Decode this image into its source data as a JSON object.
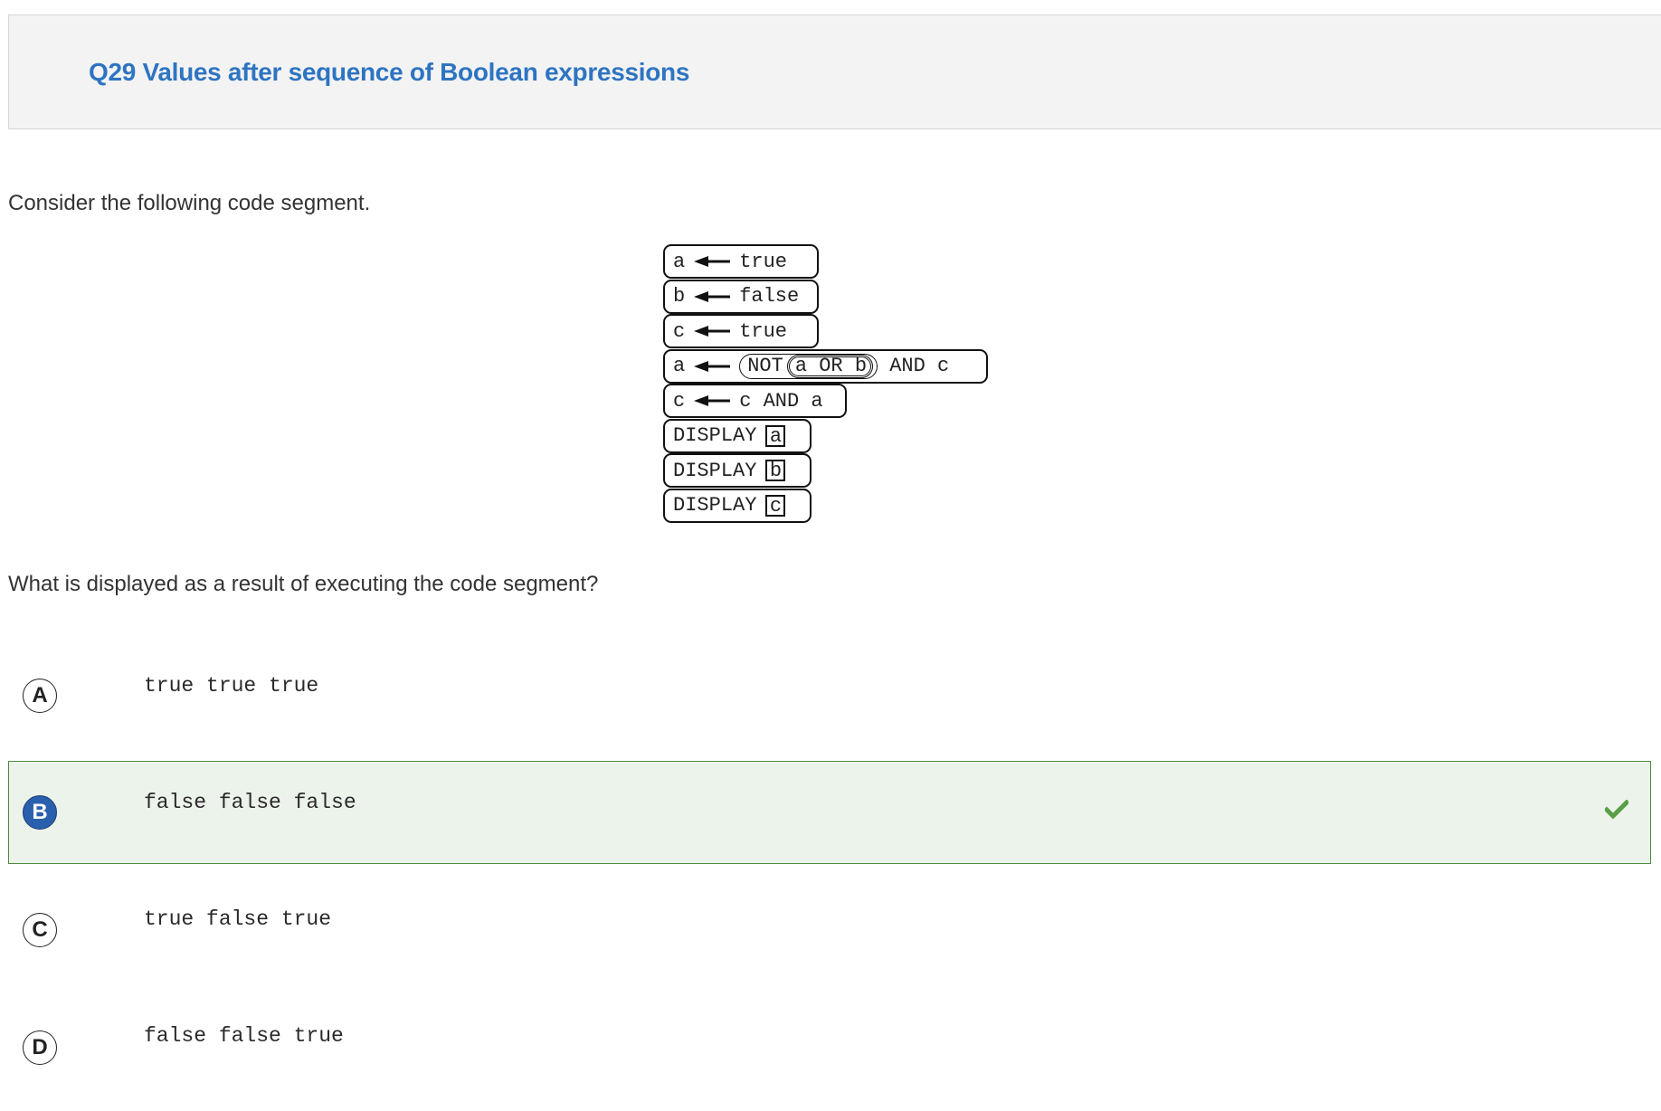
{
  "header": {
    "title": "Q29 Values after sequence of Boolean expressions"
  },
  "question": {
    "intro": "Consider the following code segment.",
    "prompt": "What is displayed as a result of executing the code segment?"
  },
  "code": {
    "lines": [
      {
        "type": "assign",
        "var": "a",
        "arrow": "assign-arrow-icon",
        "expr": "true"
      },
      {
        "type": "assign",
        "var": "b",
        "arrow": "assign-arrow-icon",
        "expr": "false"
      },
      {
        "type": "assign",
        "var": "c",
        "arrow": "assign-arrow-icon",
        "expr": "true"
      },
      {
        "type": "assign-compound",
        "var": "a",
        "arrow": "assign-arrow-icon",
        "not_kw": "NOT",
        "inner_left": "a",
        "inner_op": "OR",
        "inner_right": "b",
        "outer_op": "AND",
        "outer_right": "c"
      },
      {
        "type": "assign",
        "var": "c",
        "arrow": "assign-arrow-icon",
        "expr": "c AND a"
      },
      {
        "type": "display",
        "keyword": "DISPLAY",
        "arg": "a"
      },
      {
        "type": "display",
        "keyword": "DISPLAY",
        "arg": "b"
      },
      {
        "type": "display",
        "keyword": "DISPLAY",
        "arg": "c"
      }
    ]
  },
  "options": [
    {
      "letter": "A",
      "text": "true true true",
      "selected": false
    },
    {
      "letter": "B",
      "text": "false false false",
      "selected": true,
      "correct_icon": "check-icon"
    },
    {
      "letter": "C",
      "text": "true false true",
      "selected": false
    },
    {
      "letter": "D",
      "text": "false false true",
      "selected": false
    }
  ],
  "colors": {
    "title": "#2e74c2",
    "header_bg": "#f3f3f3",
    "selected_bg": "#ecf3eb",
    "selected_border": "#4e8a3e",
    "selected_letter_bg": "#2a5fad",
    "check": "#5a9e48"
  }
}
